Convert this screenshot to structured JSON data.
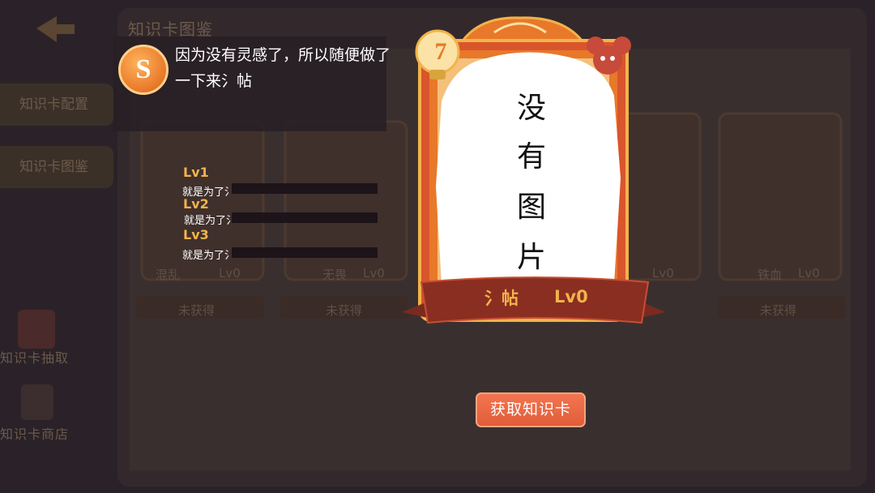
{
  "background": {
    "panel_title": "知识卡图鉴",
    "side_buttons": [
      "知识卡配置",
      "知识卡图鉴"
    ],
    "side_icons": [
      "知识卡抽取",
      "知识卡商店"
    ],
    "cards": [
      {
        "name": "混乱",
        "level": "Lv0",
        "status": "未获得"
      },
      {
        "name": "无畏",
        "level": "Lv0",
        "status": "未获得"
      },
      {
        "name": "",
        "level": "Lv0",
        "status": ""
      },
      {
        "name": "铁血",
        "level": "Lv0",
        "status": "未获得"
      }
    ]
  },
  "detail": {
    "description": "因为没有灵感了，所以随便做了一下来氵帖",
    "levels": [
      {
        "label": "Lv1",
        "text": "就是为了氵"
      },
      {
        "label": "Lv2",
        "text": "就是为了氵"
      },
      {
        "label": "Lv3",
        "text": "就是为了氵"
      }
    ]
  },
  "card": {
    "cost": "7",
    "image_placeholder": [
      "没",
      "有",
      "图",
      "片"
    ],
    "name": "氵帖",
    "level": "Lv0"
  },
  "actions": {
    "get_card": "获取知识卡"
  },
  "colors": {
    "accent_orange": "#e8782a",
    "gold": "#f2b34a",
    "button": "#e25c3a"
  }
}
